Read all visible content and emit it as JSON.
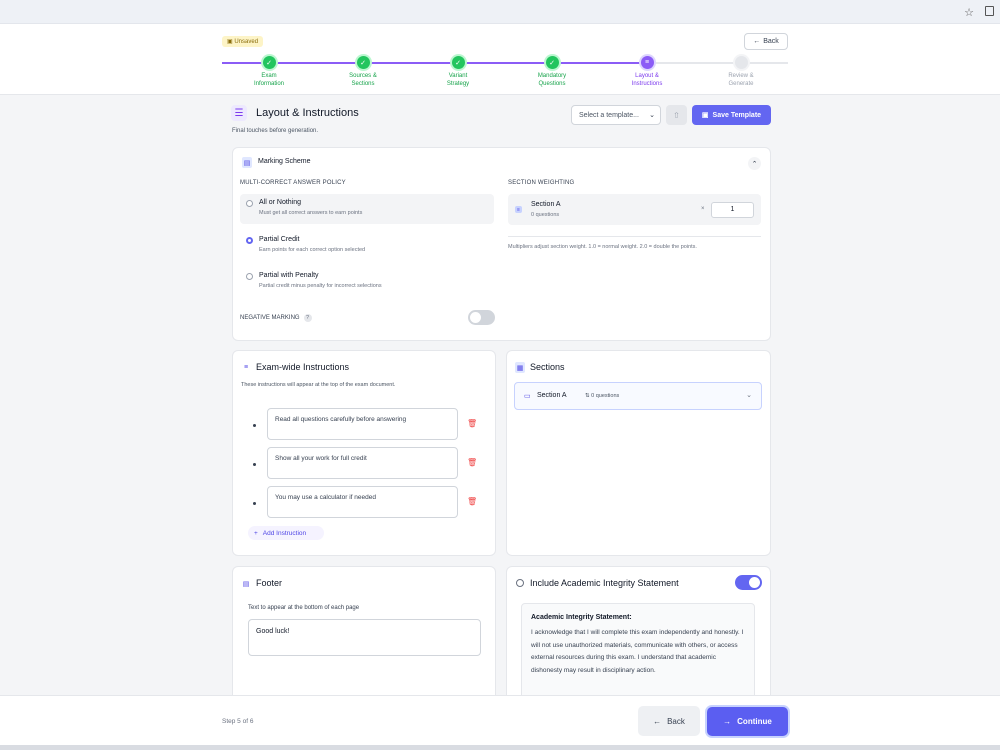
{
  "status": {
    "unsaved": "Unsaved"
  },
  "header": {
    "back_label": "Back"
  },
  "stepper": {
    "steps": [
      {
        "label": "Exam\nInformation",
        "state": "done"
      },
      {
        "label": "Sources &\nSections",
        "state": "done"
      },
      {
        "label": "Variant\nStrategy",
        "state": "done"
      },
      {
        "label": "Mandatory\nQuestions",
        "state": "done"
      },
      {
        "label": "Layout &\nInstructions",
        "state": "active"
      },
      {
        "label": "Review &\nGenerate",
        "state": "todo"
      }
    ]
  },
  "page": {
    "title": "Layout & Instructions",
    "subtitle": "Final touches before generation.",
    "template_placeholder": "Select a template...",
    "save_template": "Save Template"
  },
  "marking": {
    "title": "Marking Scheme",
    "policy_heading": "MULTI-CORRECT ANSWER POLICY",
    "options": [
      {
        "label": "All or Nothing",
        "desc": "Must get all correct answers to earn points",
        "selected": false
      },
      {
        "label": "Partial Credit",
        "desc": "Earn points for each correct option selected",
        "selected": true
      },
      {
        "label": "Partial with Penalty",
        "desc": "Partial credit minus penalty for incorrect selections",
        "selected": false
      }
    ],
    "negative_label": "NEGATIVE MARKING",
    "negative_help": "?",
    "negative_enabled": false,
    "weighting_heading": "SECTION WEIGHTING",
    "weighting_section": "Section A",
    "weighting_count": "0 questions",
    "weighting_x": "×",
    "weighting_value": "1",
    "weighting_note": "Multipliers adjust section weight. 1.0 = normal weight. 2.0 = double the points."
  },
  "instructions": {
    "title": "Exam-wide Instructions",
    "subtitle": "These instructions will appear at the top of the exam document.",
    "items": [
      "Read all questions carefully before answering",
      "Show all your work for full credit",
      "You may use a calculator if needed"
    ],
    "add_label": "Add Instruction"
  },
  "sections": {
    "title": "Sections",
    "items": [
      {
        "name": "Section A",
        "questions": "0 questions"
      }
    ]
  },
  "footer": {
    "title": "Footer",
    "label": "Text to appear at the bottom of each page",
    "value": "Good luck!"
  },
  "integrity": {
    "title": "Include Academic Integrity Statement",
    "enabled": true,
    "heading": "Academic Integrity Statement:",
    "text": "I acknowledge that I will complete this exam independently and honestly. I will not use unauthorized materials, communicate with others, or access external resources during this exam. I understand that academic dishonesty may result in disciplinary action."
  },
  "bottom": {
    "step_of": "Step 5 of 6",
    "back_label": "Back",
    "continue_label": "Continue"
  },
  "colors": {
    "accent": "#6366f1",
    "done": "#22c55e",
    "active": "#8b5cf6",
    "danger": "#ef4444"
  }
}
